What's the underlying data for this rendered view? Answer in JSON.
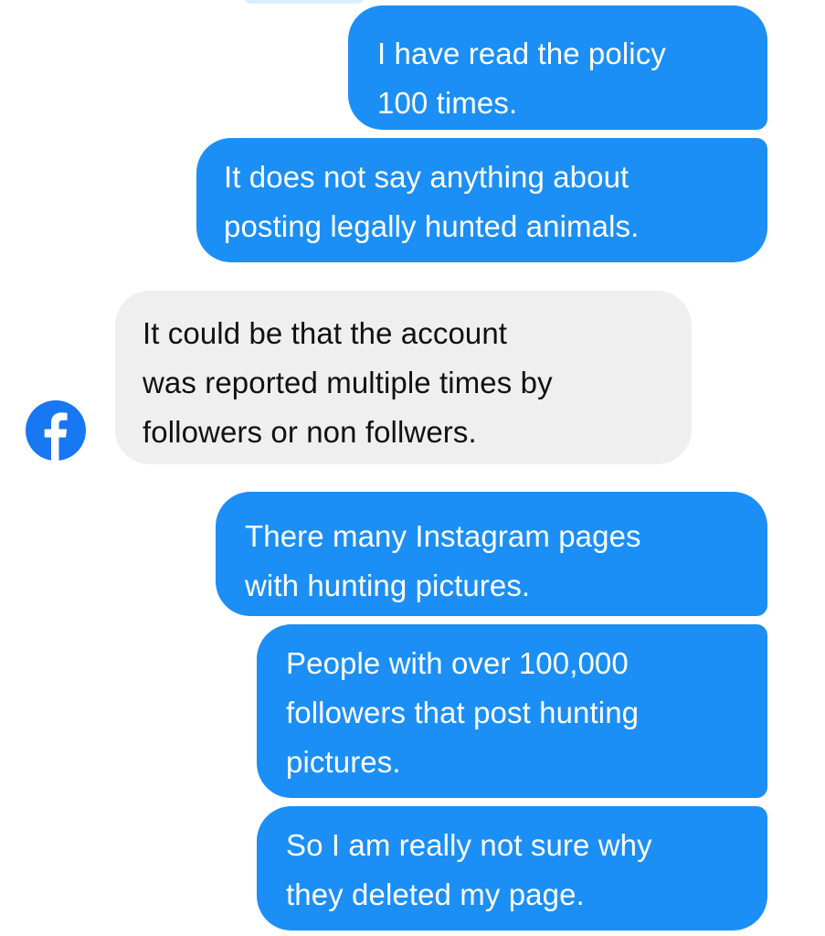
{
  "thread": {
    "messages": [
      {
        "sender": "me",
        "text": "I have read the policy\n100 times."
      },
      {
        "sender": "me",
        "text": "It does not say anything about\nposting legally hunted animals."
      },
      {
        "sender": "facebook",
        "text": "It could be that the account\nwas reported multiple times by\nfollowers or non follwers."
      },
      {
        "sender": "me",
        "text": "There many Instagram pages\nwith hunting pictures."
      },
      {
        "sender": "me",
        "text": "People with over 100,000\nfollowers that post hunting\npictures."
      },
      {
        "sender": "me",
        "text": "So I am really not sure why\nthey deleted my page."
      }
    ]
  },
  "avatar": {
    "icon": "facebook-logo-icon"
  },
  "colors": {
    "outgoing_bubble": "#1b8ff5",
    "incoming_bubble": "#efefef",
    "facebook_blue": "#1877f2"
  }
}
